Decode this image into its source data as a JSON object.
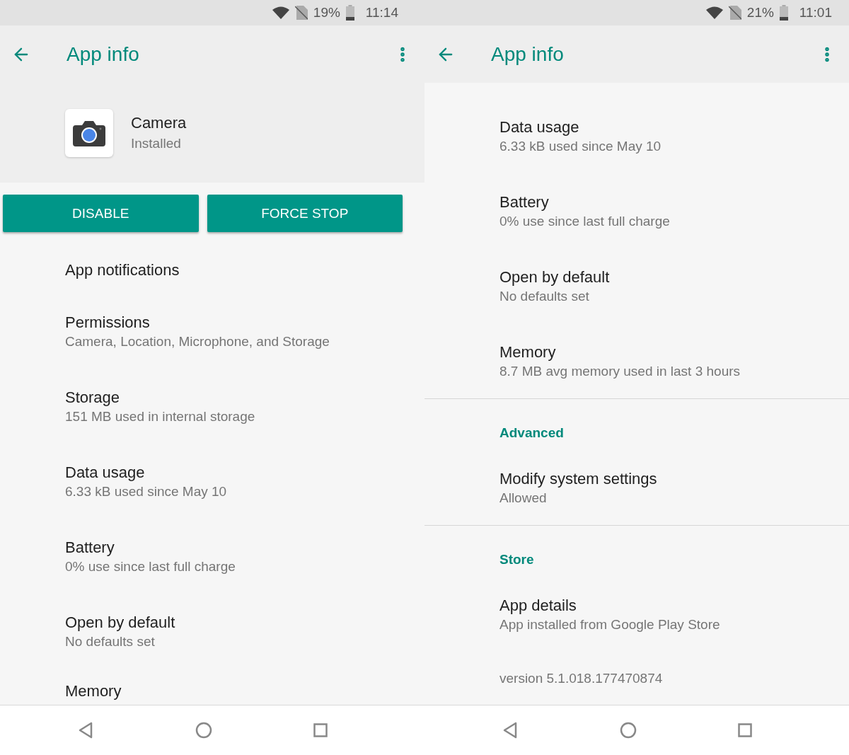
{
  "screens": [
    {
      "status_bar": {
        "battery": "19%",
        "time": "11:14"
      },
      "title": "App info",
      "app": {
        "name": "Camera",
        "status": "Installed"
      },
      "buttons": [
        "DISABLE",
        "FORCE STOP"
      ],
      "items": [
        {
          "kind": "entry",
          "title": "App notifications"
        },
        {
          "kind": "entry",
          "title": "Permissions",
          "summary": "Camera, Location, Microphone, and Storage"
        },
        {
          "kind": "entry",
          "title": "Storage",
          "summary": "151 MB used in internal storage"
        },
        {
          "kind": "entry",
          "title": "Data usage",
          "summary": "6.33 kB used since May 10"
        },
        {
          "kind": "entry",
          "title": "Battery",
          "summary": "0% use since last full charge"
        },
        {
          "kind": "entry",
          "title": "Open by default",
          "summary": "No defaults set"
        },
        {
          "kind": "entry",
          "title": "Memory"
        }
      ]
    },
    {
      "status_bar": {
        "battery": "21%",
        "time": "11:01"
      },
      "title": "App info",
      "items": [
        {
          "kind": "entry",
          "title": "Data usage",
          "summary": "6.33 kB used since May 10"
        },
        {
          "kind": "entry",
          "title": "Battery",
          "summary": "0% use since last full charge"
        },
        {
          "kind": "entry",
          "title": "Open by default",
          "summary": "No defaults set"
        },
        {
          "kind": "entry",
          "title": "Memory",
          "summary": "8.7 MB avg memory used in last 3 hours"
        },
        {
          "kind": "divider"
        },
        {
          "kind": "header",
          "title": "Advanced"
        },
        {
          "kind": "entry",
          "title": "Modify system settings",
          "summary": "Allowed"
        },
        {
          "kind": "divider"
        },
        {
          "kind": "header",
          "title": "Store"
        },
        {
          "kind": "entry",
          "title": "App details",
          "summary": "App installed from Google Play Store"
        },
        {
          "kind": "footer",
          "title": "version 5.1.018.177470874"
        }
      ]
    }
  ]
}
